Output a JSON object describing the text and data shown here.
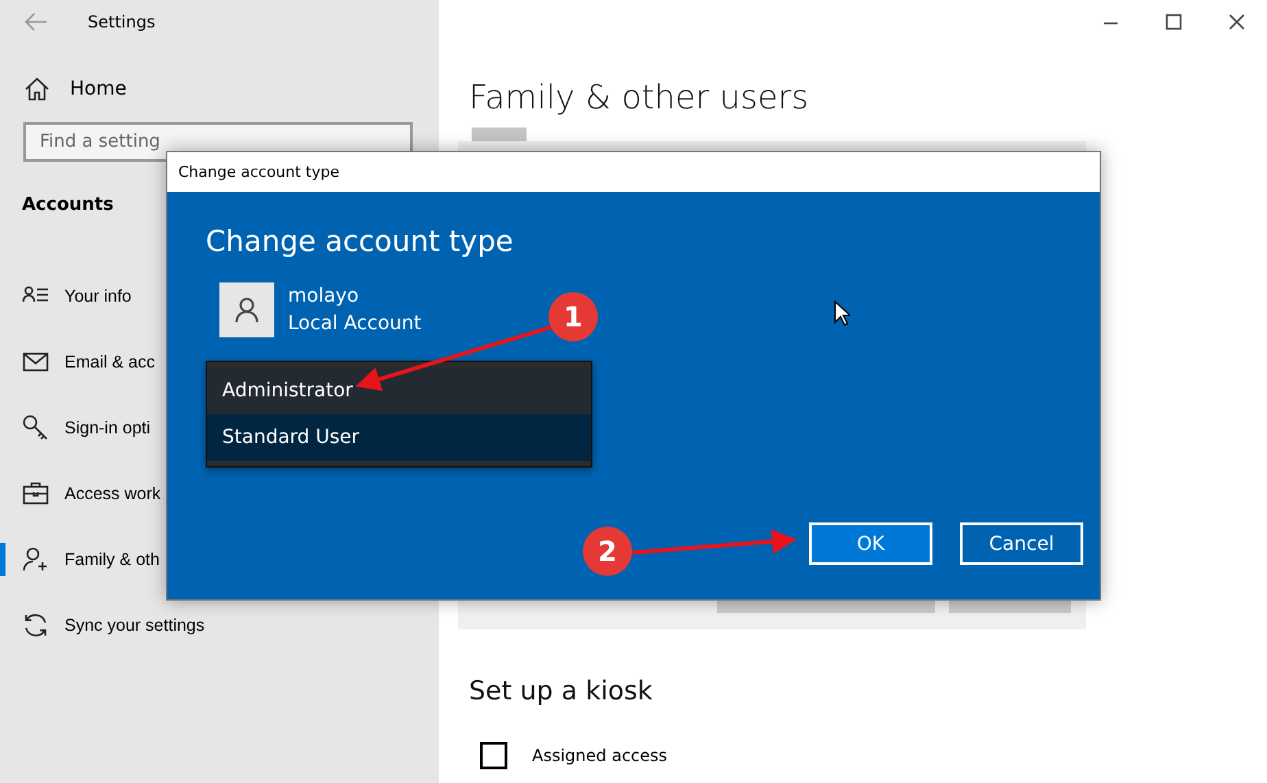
{
  "window": {
    "title": "Settings"
  },
  "sidebar": {
    "home": "Home",
    "search": {
      "placeholder": "Find a setting"
    },
    "section": "Accounts",
    "items": [
      {
        "label": "Your info",
        "selected": false
      },
      {
        "label": "Email & acc",
        "selected": false
      },
      {
        "label": "Sign-in opti",
        "selected": false
      },
      {
        "label": "Access work",
        "selected": false
      },
      {
        "label": "Family & oth",
        "selected": true
      },
      {
        "label": "Sync your settings",
        "selected": false
      }
    ]
  },
  "main": {
    "title": "Family & other users",
    "kiosk_title": "Set up a kiosk",
    "kiosk_option": {
      "label": "Assigned access"
    }
  },
  "dialog": {
    "title": "Change account type",
    "heading": "Change account type",
    "user": {
      "name": "molayo",
      "type": "Local Account"
    },
    "options": [
      {
        "label": "Administrator",
        "selected": false
      },
      {
        "label": "Standard User",
        "selected": true
      }
    ],
    "buttons": [
      {
        "label": "OK",
        "kind": "primary"
      },
      {
        "label": "Cancel",
        "kind": "secondary"
      }
    ]
  },
  "annotations": [
    {
      "label": "1"
    },
    {
      "label": "2"
    }
  ]
}
